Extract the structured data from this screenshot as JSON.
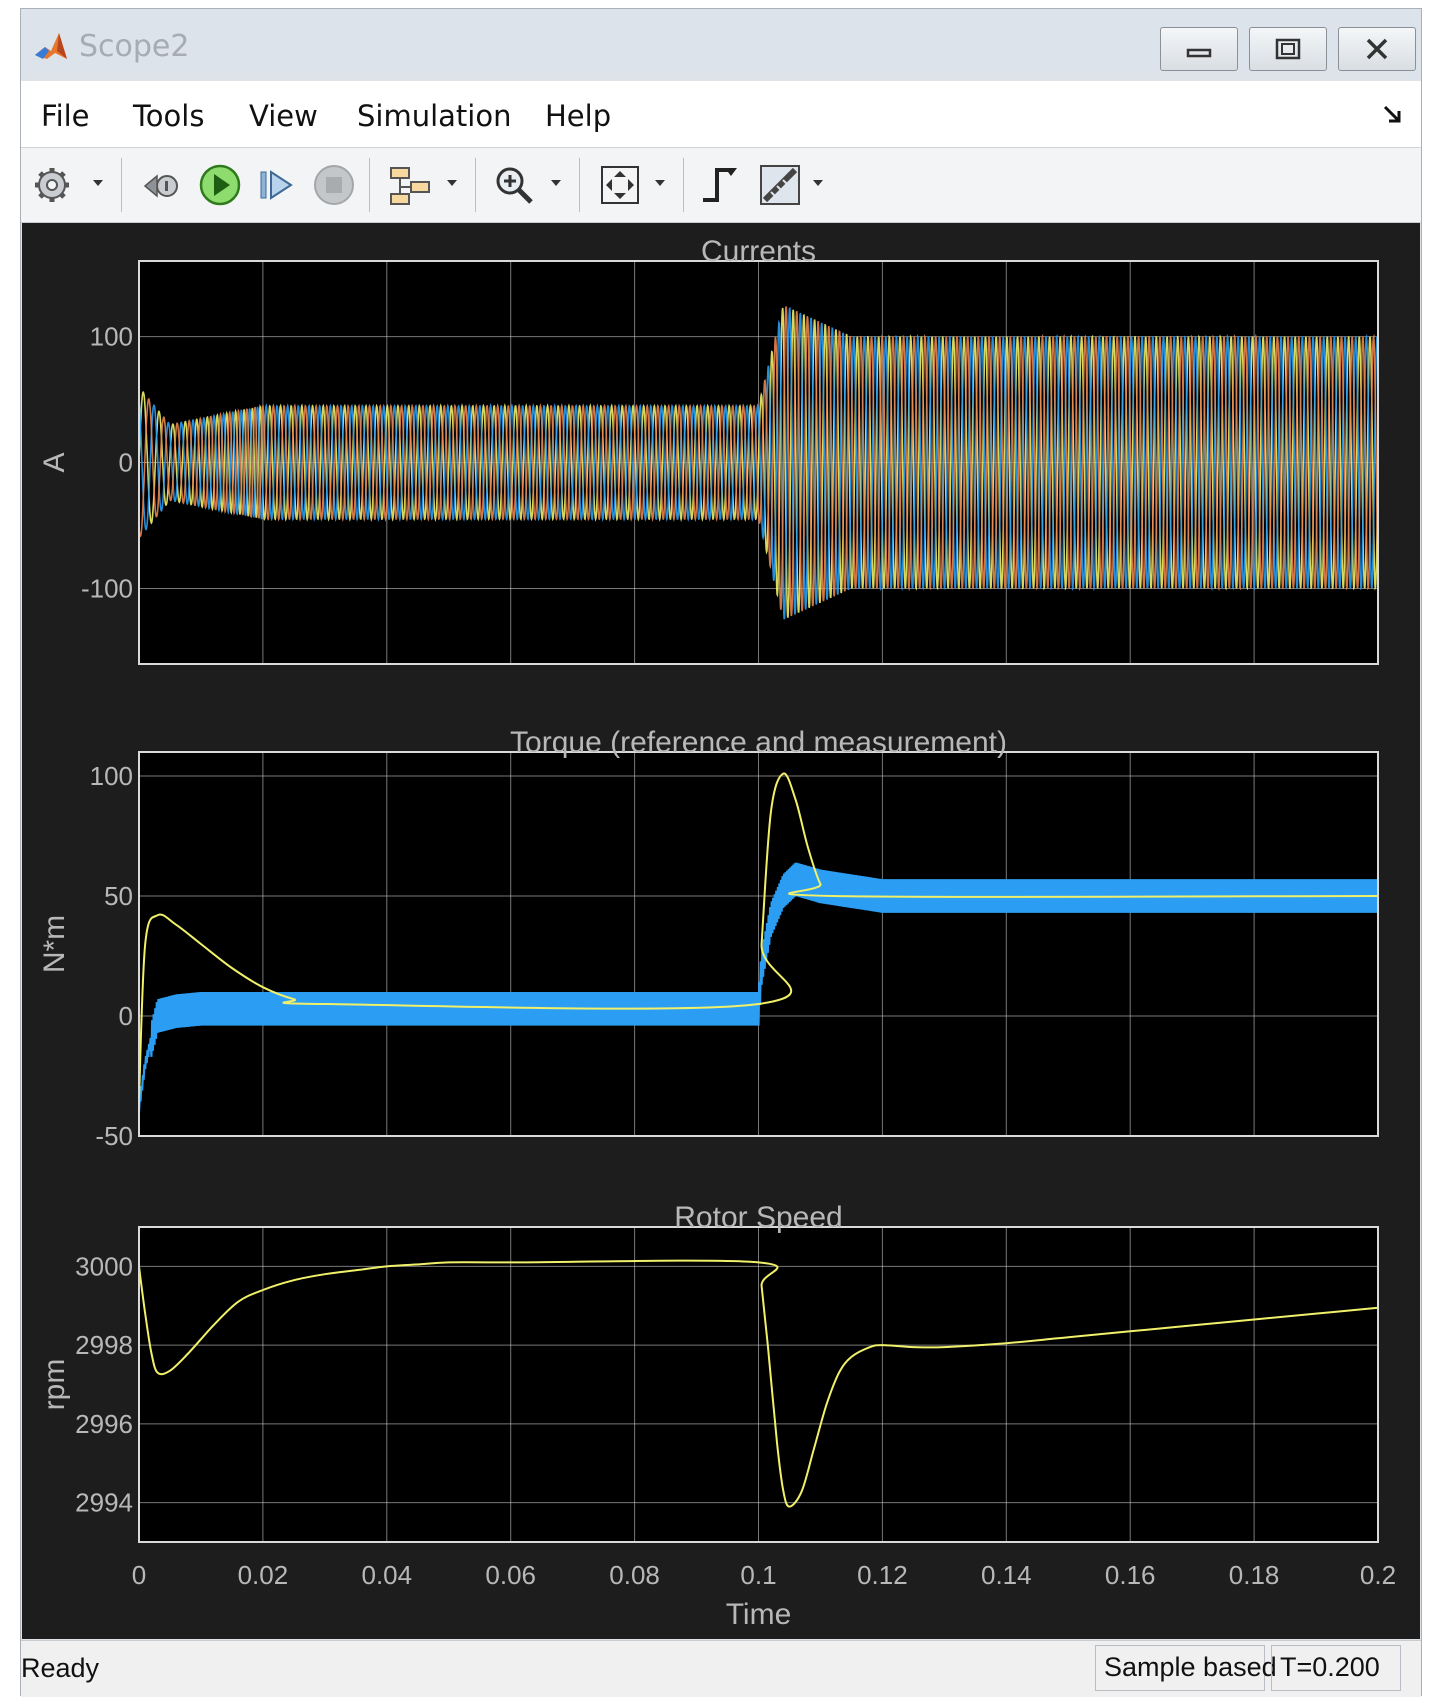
{
  "window": {
    "title": "Scope2",
    "icon": "matlab-logo-icon"
  },
  "menu": {
    "items": [
      "File",
      "Tools",
      "View",
      "Simulation",
      "Help"
    ]
  },
  "toolbar": {
    "icons": [
      "gear-icon",
      "rewind-step-icon",
      "run-icon",
      "step-forward-icon",
      "stop-icon",
      "signal-selection-icon",
      "zoom-in-icon",
      "fit-to-view-icon",
      "triggers-icon",
      "measurements-icon"
    ]
  },
  "status": {
    "left": "Ready",
    "mode": "Sample based",
    "time": "T=0.200"
  },
  "colors": {
    "scope_bg": "#1d1d1d",
    "axes_bg": "#000000",
    "grid": "#d9d9d9",
    "label": "#b8b8b8",
    "yellow": "#f0f06a",
    "blue": "#2b9df2",
    "orange": "#e8844d"
  },
  "chart_data": [
    {
      "type": "line",
      "title": "Currents",
      "xlabel": "",
      "ylabel": "A",
      "xlim": [
        0,
        0.2
      ],
      "ylim": [
        -160,
        160
      ],
      "yticks": [
        "-100",
        "0",
        "100"
      ],
      "xticks": [],
      "grid": true,
      "series": [
        {
          "color": "#f0f06a",
          "description": "three-phase stator current, phase 1",
          "amplitude_by_time": [
            [
              0,
              60
            ],
            [
              0.005,
              30
            ],
            [
              0.02,
              45
            ],
            [
              0.1,
              45
            ],
            [
              0.104,
              125
            ],
            [
              0.115,
              100
            ],
            [
              0.2,
              100
            ]
          ]
        },
        {
          "color": "#2b9df2",
          "description": "three-phase stator current, phase 2",
          "amplitude_by_time": [
            [
              0,
              60
            ],
            [
              0.005,
              30
            ],
            [
              0.02,
              45
            ],
            [
              0.1,
              45
            ],
            [
              0.104,
              125
            ],
            [
              0.115,
              100
            ],
            [
              0.2,
              100
            ]
          ]
        },
        {
          "color": "#e8844d",
          "description": "three-phase stator current, phase 3",
          "amplitude_by_time": [
            [
              0,
              60
            ],
            [
              0.005,
              30
            ],
            [
              0.02,
              45
            ],
            [
              0.1,
              45
            ],
            [
              0.104,
              125
            ],
            [
              0.115,
              100
            ],
            [
              0.2,
              100
            ]
          ]
        }
      ]
    },
    {
      "type": "line",
      "title": "Torque (reference and measurement)",
      "xlabel": "",
      "ylabel": "N*m",
      "xlim": [
        0,
        0.2
      ],
      "ylim": [
        -50,
        110
      ],
      "yticks": [
        "-50",
        "0",
        "50",
        "100"
      ],
      "xticks": [],
      "grid": true,
      "series": [
        {
          "color": "#f0f06a",
          "x": [
            0,
            0.001,
            0.003,
            0.006,
            0.01,
            0.015,
            0.02,
            0.025,
            0.03,
            0.1,
            0.1005,
            0.102,
            0.104,
            0.106,
            0.108,
            0.11,
            0.112,
            0.2
          ],
          "y": [
            -35,
            30,
            42,
            38,
            30,
            20,
            12,
            7,
            5,
            5,
            30,
            85,
            101,
            90,
            70,
            55,
            50,
            50
          ]
        },
        {
          "color": "#2b9df2",
          "x": [
            0,
            0.001,
            0.003,
            0.006,
            0.01,
            0.015,
            0.03,
            0.1,
            0.1005,
            0.102,
            0.104,
            0.106,
            0.11,
            0.12,
            0.2
          ],
          "y": [
            -38,
            -20,
            0,
            2,
            3,
            3,
            3,
            3,
            20,
            40,
            52,
            57,
            54,
            50,
            50
          ],
          "ripple": 7
        }
      ]
    },
    {
      "type": "line",
      "title": "Rotor Speed",
      "xlabel": "Time",
      "ylabel": "rpm",
      "xlim": [
        0,
        0.2
      ],
      "ylim": [
        2993,
        3001
      ],
      "yticks": [
        "2994",
        "2996",
        "2998",
        "3000"
      ],
      "xticks": [
        "0",
        "0.02",
        "0.04",
        "0.06",
        "0.08",
        "0.1",
        "0.12",
        "0.14",
        "0.16",
        "0.18",
        "0.2"
      ],
      "grid": true,
      "series": [
        {
          "color": "#f0f06a",
          "x": [
            0,
            0.001,
            0.002,
            0.003,
            0.005,
            0.008,
            0.012,
            0.016,
            0.02,
            0.025,
            0.03,
            0.035,
            0.04,
            0.045,
            0.05,
            0.06,
            0.1,
            0.1005,
            0.1015,
            0.103,
            0.104,
            0.105,
            0.107,
            0.109,
            0.111,
            0.113,
            0.115,
            0.118,
            0.12,
            0.125,
            0.13,
            0.14,
            0.15,
            0.16,
            0.17,
            0.18,
            0.19,
            0.2
          ],
          "y": [
            3000,
            2998.8,
            2997.8,
            2997.3,
            2997.35,
            2997.8,
            2998.5,
            2999.1,
            2999.4,
            2999.65,
            2999.8,
            2999.9,
            3000.0,
            3000.05,
            3000.1,
            3000.1,
            3000.1,
            2999.5,
            2998.0,
            2995.5,
            2994.3,
            2993.9,
            2994.3,
            2995.4,
            2996.5,
            2997.3,
            2997.7,
            2997.95,
            2998.0,
            2997.95,
            2997.95,
            2998.05,
            2998.2,
            2998.35,
            2998.5,
            2998.65,
            2998.8,
            2998.95
          ]
        }
      ]
    }
  ]
}
